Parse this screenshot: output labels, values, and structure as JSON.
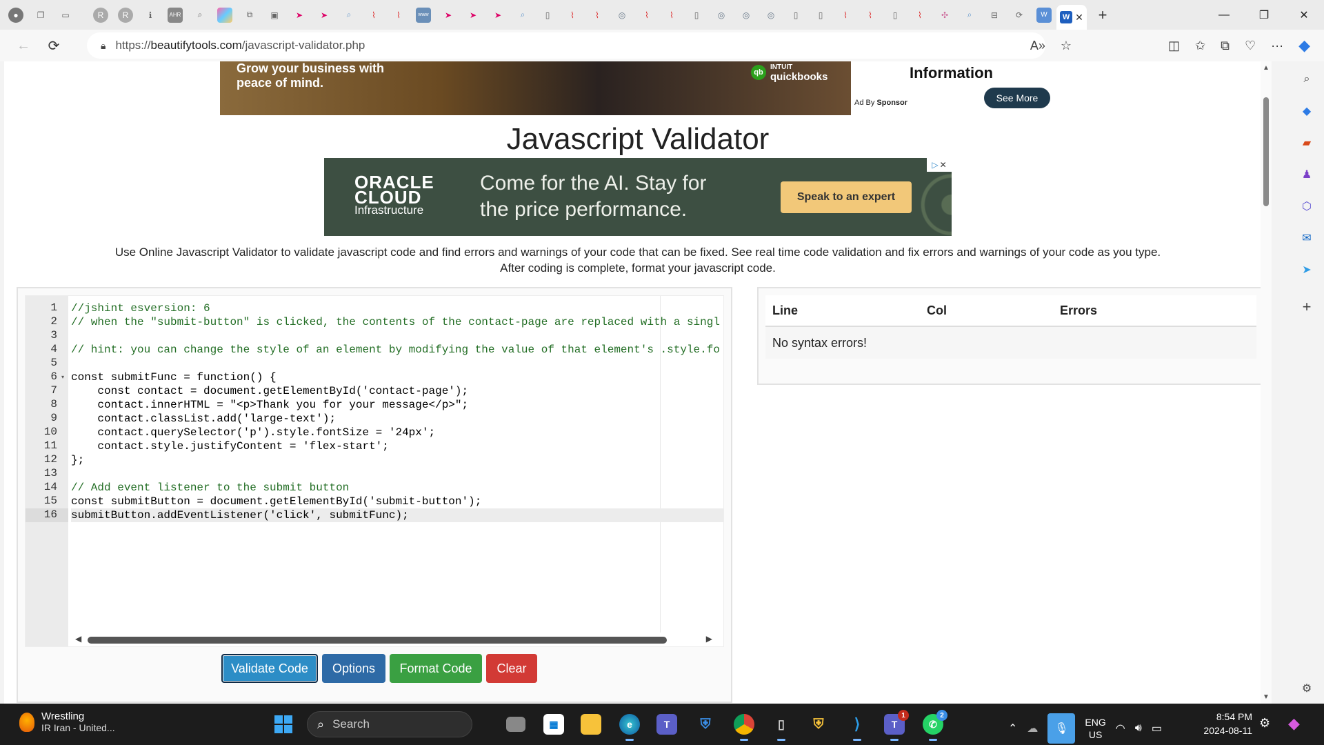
{
  "browser": {
    "url_prefix": "https://",
    "url_host": "beautifytools.com",
    "url_path": "/javascript-validator.php"
  },
  "ads": {
    "top_copy": "Grow your business with peace of mind.",
    "top_brand_line1": "INTUIT",
    "top_brand_line2": "quickbooks",
    "top_brand_mark": "qb",
    "info_title": "Information",
    "ad_by_label": "Ad By",
    "ad_by_sponsor": "Sponsor",
    "see_more": "See More",
    "oracle_logo_line1": "ORACLE",
    "oracle_logo_line2": "CLOUD",
    "oracle_sub": "Infrastructure",
    "oracle_headline": "Come for the AI. Stay for the price performance.",
    "oracle_cta": "Speak to an expert"
  },
  "page": {
    "title": "Javascript Validator",
    "description": "Use Online Javascript Validator to validate javascript code and find errors and warnings of your code that can be fixed. See real time code validation and fix errors and warnings of your code as you type. After coding is complete, format your javascript code."
  },
  "editor": {
    "lines": [
      {
        "n": "1",
        "text": "//jshint esversion: 6"
      },
      {
        "n": "2",
        "text": "// when the \"submit-button\" is clicked, the contents of the contact-page are replaced with a singl"
      },
      {
        "n": "3",
        "text": ""
      },
      {
        "n": "4",
        "text": "// hint: you can change the style of an element by modifying the value of that element's .style.fo"
      },
      {
        "n": "5",
        "text": ""
      },
      {
        "n": "6",
        "text": "const submitFunc = function() {"
      },
      {
        "n": "7",
        "text": "    const contact = document.getElementById('contact-page');"
      },
      {
        "n": "8",
        "text": "    contact.innerHTML = \"<p>Thank you for your message</p>\";"
      },
      {
        "n": "9",
        "text": "    contact.classList.add('large-text');"
      },
      {
        "n": "10",
        "text": "    contact.querySelector('p').style.fontSize = '24px';"
      },
      {
        "n": "11",
        "text": "    contact.style.justifyContent = 'flex-start';"
      },
      {
        "n": "12",
        "text": "};"
      },
      {
        "n": "13",
        "text": ""
      },
      {
        "n": "14",
        "text": "// Add event listener to the submit button"
      },
      {
        "n": "15",
        "text": "const submitButton = document.getElementById('submit-button');"
      },
      {
        "n": "16",
        "text": "submitButton.addEventListener('click', submitFunc);"
      }
    ],
    "current_line": 16
  },
  "buttons": {
    "validate": "Validate Code",
    "options": "Options",
    "format": "Format Code",
    "clear": "Clear"
  },
  "results": {
    "col_line": "Line",
    "col_col": "Col",
    "col_errors": "Errors",
    "message": "No syntax errors!"
  },
  "taskbar": {
    "weather_title": "Wrestling",
    "weather_sub": "IR Iran - United...",
    "search_placeholder": "Search",
    "lang_line1": "ENG",
    "lang_line2": "US",
    "time": "8:54 PM",
    "date": "2024-08-11",
    "teams_badge": "1",
    "whatsapp_badge": "2"
  }
}
